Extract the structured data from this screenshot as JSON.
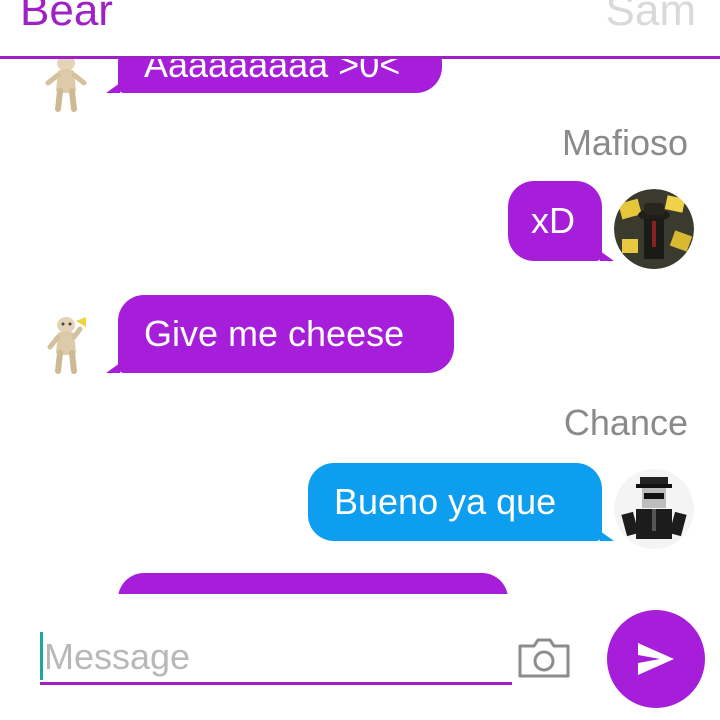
{
  "header": {
    "title_left": "Bear",
    "title_right": "Sam"
  },
  "messages": [
    {
      "id": "m1",
      "direction": "incoming",
      "text": "Aaaaaaaaa >0<",
      "color": "#a61ed9",
      "avatar": "bear-figure-icon"
    },
    {
      "id": "m2",
      "direction": "outgoing",
      "sender": "Mafioso",
      "text": "xD",
      "color": "#a61ed9",
      "avatar": "mafioso-avatar"
    },
    {
      "id": "m3",
      "direction": "incoming",
      "text": "Give me cheese",
      "color": "#a61ed9",
      "avatar": "bear-with-cheese-icon"
    },
    {
      "id": "m4",
      "direction": "outgoing",
      "sender": "Chance",
      "text": "Bueno ya que",
      "color": "#0e9ef0",
      "avatar": "chance-avatar"
    },
    {
      "id": "m5",
      "direction": "incoming",
      "text": "",
      "color": "#a61ed9"
    }
  ],
  "composer": {
    "placeholder": "Message",
    "camera_icon": "camera-icon",
    "send_icon": "send-arrow-icon"
  },
  "colors": {
    "accent": "#a020c8",
    "bubble_purple": "#a61ed9",
    "bubble_blue": "#0e9ef0",
    "sender_gray": "#8a8a8a"
  }
}
